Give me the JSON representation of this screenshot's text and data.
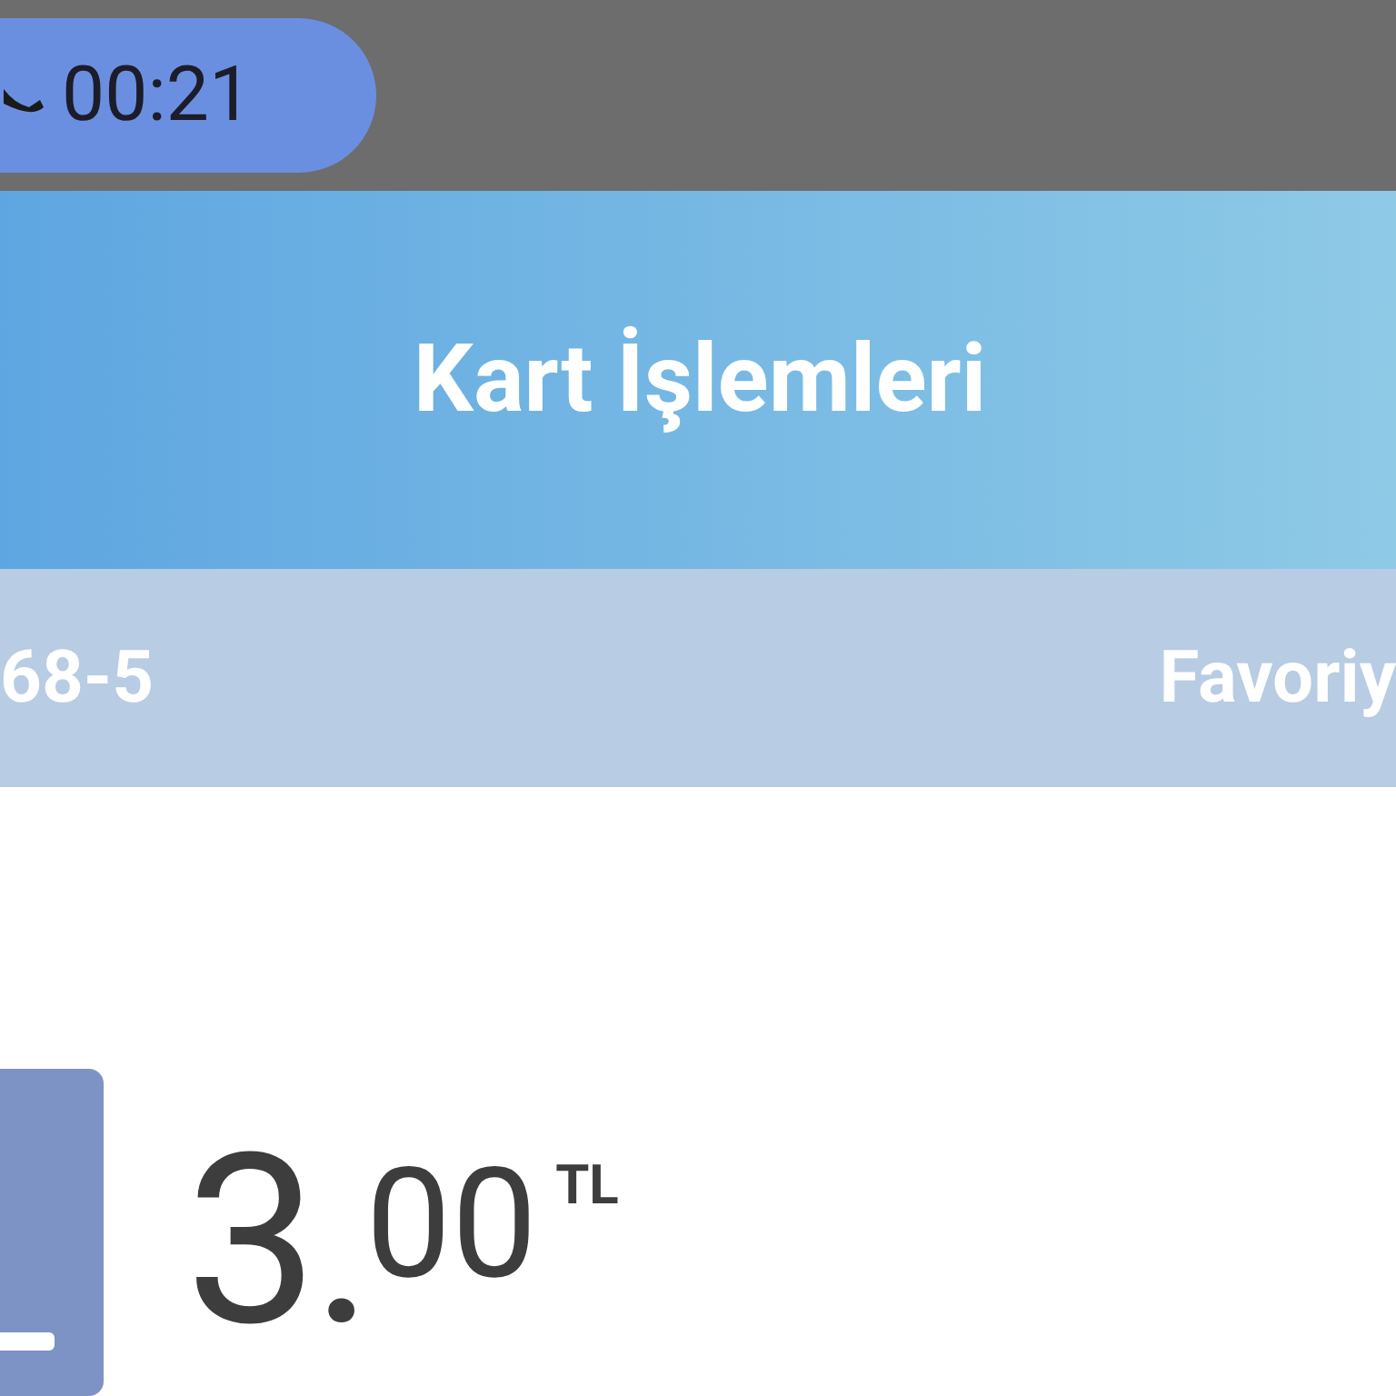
{
  "status_bar": {
    "call_timer": "00:21"
  },
  "header": {
    "title": "Kart İşlemleri"
  },
  "card_bar": {
    "card_number": "68-5",
    "favorite_label": "Favoriy"
  },
  "balance": {
    "integer": "3",
    "separator": ".",
    "decimals": "00",
    "currency": "TL"
  }
}
